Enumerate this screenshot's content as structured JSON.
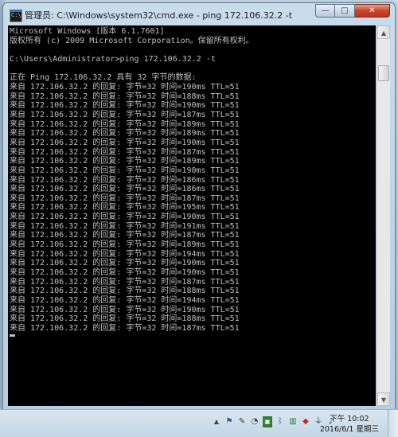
{
  "window": {
    "title": "管理员: C:\\Windows\\system32\\cmd.exe - ping  172.106.32.2 -t",
    "app_icon": "cmd-icon",
    "controls": {
      "minimize": "—",
      "maximize": "□",
      "close": "✕"
    }
  },
  "console": {
    "text": "Microsoft Windows [版本 6.1.7601]\n版权所有 (c) 2009 Microsoft Corporation。保留所有权利。\n\nC:\\Users\\Administrator>ping 172.106.32.2 -t\n\n正在 Ping 172.106.32.2 具有 32 字节的数据:\n来自 172.106.32.2 的回复: 字节=32 时间=190ms TTL=51\n来自 172.106.32.2 的回复: 字节=32 时间=188ms TTL=51\n来自 172.106.32.2 的回复: 字节=32 时间=190ms TTL=51\n来自 172.106.32.2 的回复: 字节=32 时间=187ms TTL=51\n来自 172.106.32.2 的回复: 字节=32 时间=189ms TTL=51\n来自 172.106.32.2 的回复: 字节=32 时间=189ms TTL=51\n来自 172.106.32.2 的回复: 字节=32 时间=190ms TTL=51\n来自 172.106.32.2 的回复: 字节=32 时间=187ms TTL=51\n来自 172.106.32.2 的回复: 字节=32 时间=189ms TTL=51\n来自 172.106.32.2 的回复: 字节=32 时间=190ms TTL=51\n来自 172.106.32.2 的回复: 字节=32 时间=186ms TTL=51\n来自 172.106.32.2 的回复: 字节=32 时间=186ms TTL=51\n来自 172.106.32.2 的回复: 字节=32 时间=187ms TTL=51\n来自 172.106.32.2 的回复: 字节=32 时间=195ms TTL=51\n来自 172.106.32.2 的回复: 字节=32 时间=190ms TTL=51\n来自 172.106.32.2 的回复: 字节=32 时间=191ms TTL=51\n来自 172.106.32.2 的回复: 字节=32 时间=187ms TTL=51\n来自 172.106.32.2 的回复: 字节=32 时间=189ms TTL=51\n来自 172.106.32.2 的回复: 字节=32 时间=194ms TTL=51\n来自 172.106.32.2 的回复: 字节=32 时间=190ms TTL=51\n来自 172.106.32.2 的回复: 字节=32 时间=190ms TTL=51\n来自 172.106.32.2 的回复: 字节=32 时间=187ms TTL=51\n来自 172.106.32.2 的回复: 字节=32 时间=188ms TTL=51\n来自 172.106.32.2 的回复: 字节=32 时间=194ms TTL=51\n来自 172.106.32.2 的回复: 字节=32 时间=190ms TTL=51\n来自 172.106.32.2 的回复: 字节=32 时间=188ms TTL=51\n来自 172.106.32.2 的回复: 字节=32 时间=187ms TTL=51",
    "colors": {
      "background": "#000000",
      "foreground": "#c0c0c0"
    }
  },
  "taskbar": {
    "tray_icons": [
      "tray-expand-icon",
      "flag-icon",
      "input-method-icon",
      "volume-icon",
      "nvidia-icon",
      "bluetooth-icon",
      "network-icon",
      "security-icon",
      "usb-icon",
      "speaker-icon"
    ],
    "clock": {
      "time": "下午 10:02",
      "date": "2016/6/1 星期三"
    }
  }
}
